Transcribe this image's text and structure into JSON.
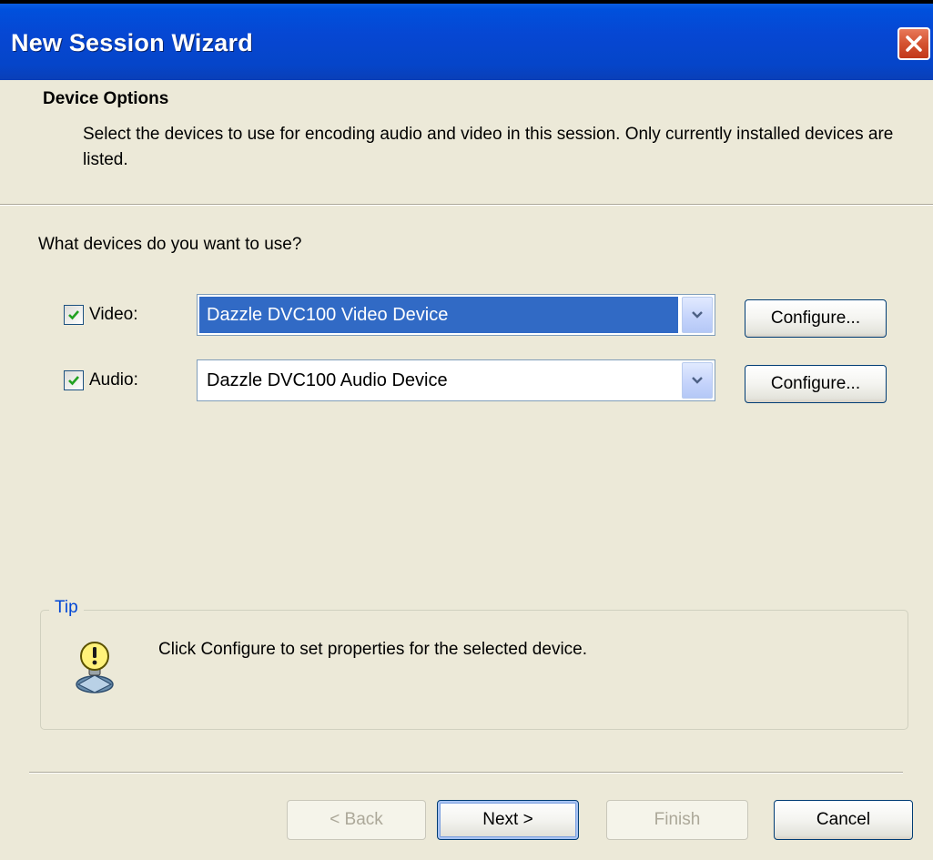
{
  "window": {
    "title": "New Session Wizard"
  },
  "header": {
    "title": "Device Options",
    "description": "Select the devices to use for encoding audio and video in this session. Only currently installed devices are listed."
  },
  "question": "What devices do you want to use?",
  "devices": [
    {
      "checkbox_label": "Video:",
      "checked": true,
      "selected_device": "Dazzle DVC100 Video Device",
      "configure_label": "Configure..."
    },
    {
      "checkbox_label": "Audio:",
      "checked": true,
      "selected_device": "Dazzle DVC100 Audio Device",
      "configure_label": "Configure..."
    }
  ],
  "tip": {
    "legend": "Tip",
    "text": "Click Configure to set properties for the selected device.",
    "icon": "lightbulb-icon"
  },
  "footer": {
    "back_label": "< Back",
    "next_label": "Next >",
    "finish_label": "Finish",
    "cancel_label": "Cancel"
  },
  "colors": {
    "titlebar": "#0545C9",
    "dialog_bg": "#ECE9D8",
    "selection": "#316AC5",
    "tip_legend": "#0046D5",
    "close_button": "#D45230"
  }
}
